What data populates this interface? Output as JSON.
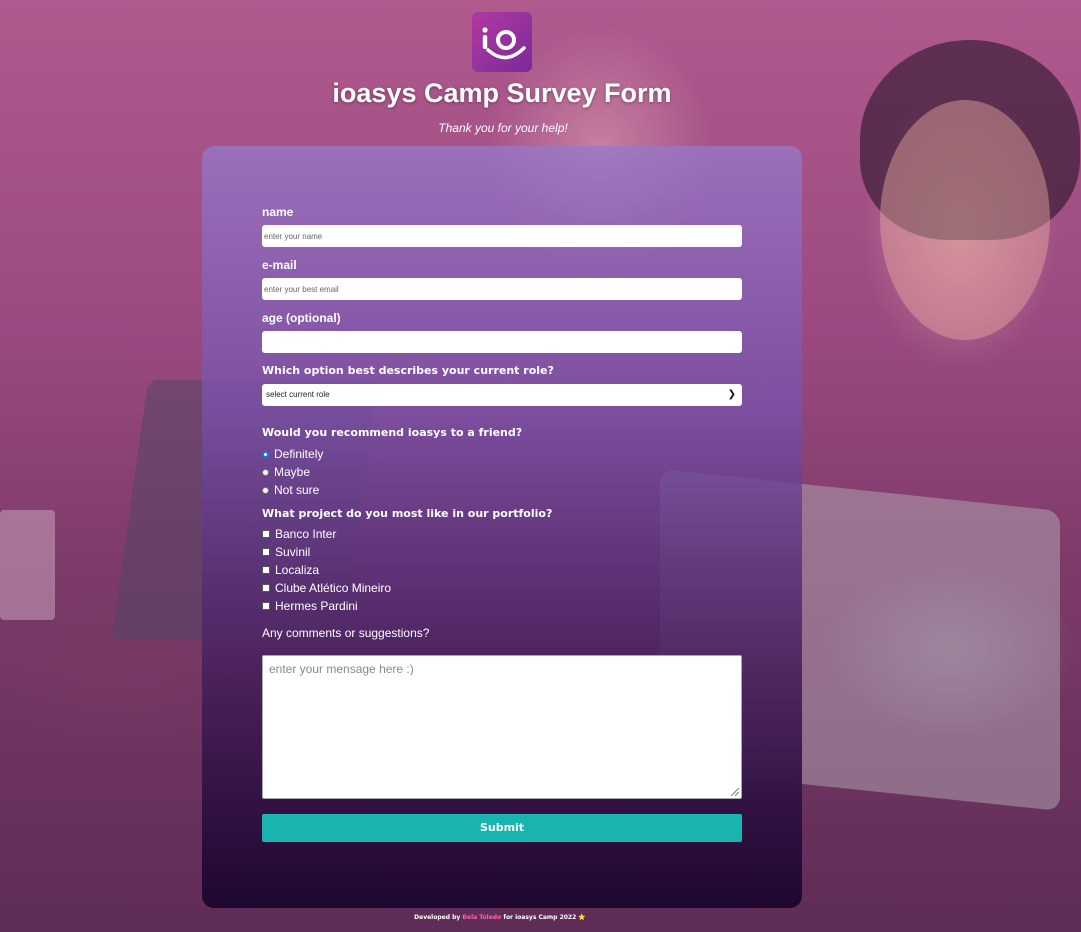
{
  "brand": {
    "logo_icon": "ioasys-logo-icon",
    "accent": "#19b4b0",
    "author_color": "#ff5fb0"
  },
  "header": {
    "title": "ioasys Camp Survey Form",
    "subtitle": "Thank you for your help!"
  },
  "form": {
    "name": {
      "label": "name",
      "placeholder": "enter your name",
      "value": ""
    },
    "email": {
      "label": "e-mail",
      "placeholder": "enter your best email",
      "value": ""
    },
    "age": {
      "label": "age (optional)",
      "placeholder": "",
      "value": ""
    },
    "role": {
      "question": "Which option best describes your current role?",
      "selected": "select current role"
    },
    "recommend": {
      "question": "Would you recommend ioasys to a friend?",
      "options": [
        "Definitely",
        "Maybe",
        "Not sure"
      ],
      "selected": "Definitely"
    },
    "projects": {
      "question": "What project do you most like in our portfolio?",
      "options": [
        "Banco Inter",
        "Suvinil",
        "Localiza",
        "Clube Atlético Mineiro",
        "Hermes Pardini"
      ]
    },
    "comments": {
      "label": "Any comments or suggestions?",
      "placeholder": "enter your mensage here :)"
    },
    "submit_label": "Submit"
  },
  "footer": {
    "prefix": "Developed by",
    "author": "Bela Toledo",
    "suffix": "for ioasys Camp 2022",
    "star": "⭐"
  }
}
